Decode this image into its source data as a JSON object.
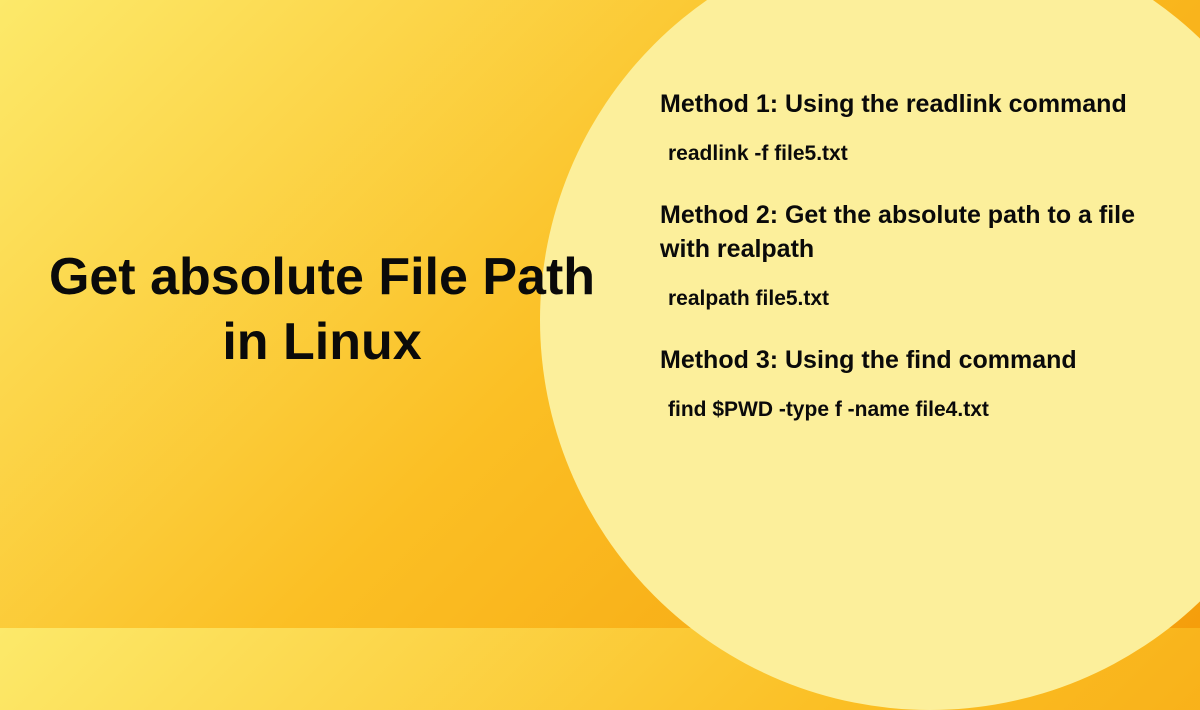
{
  "title": "Get absolute File Path in Linux",
  "methods": [
    {
      "heading": "Method 1: Using the readlink command",
      "command": "readlink -f file5.txt"
    },
    {
      "heading": "Method 2: Get the absolute path to a file with realpath",
      "command": "realpath file5.txt"
    },
    {
      "heading": "Method 3: Using the find command",
      "command": "find $PWD -type f -name file4.txt"
    }
  ]
}
